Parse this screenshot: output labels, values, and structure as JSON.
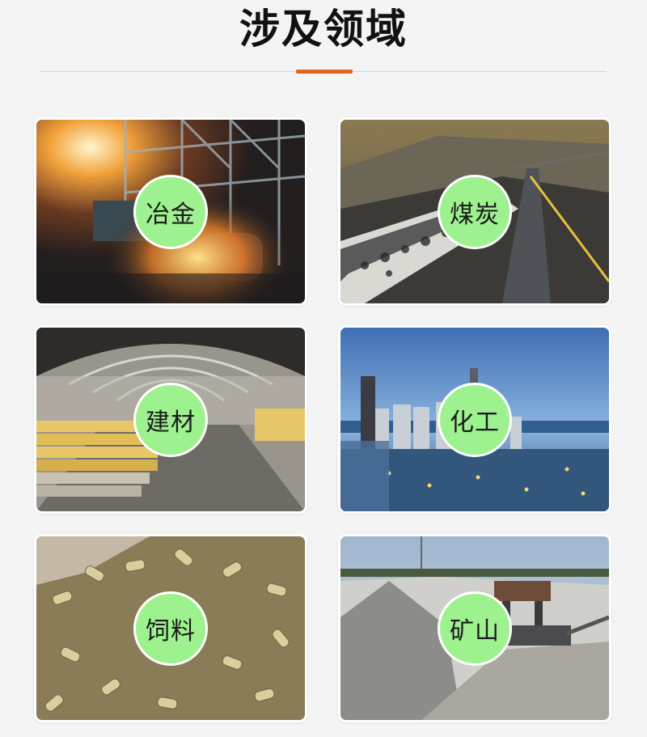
{
  "header": {
    "title": "涉及领域"
  },
  "fields": [
    {
      "label": "冶金",
      "image": "metallurgy-furnace-sparks-photo"
    },
    {
      "label": "煤炭",
      "image": "coal-conveyor-belt-photo"
    },
    {
      "label": "建材",
      "image": "building-materials-warehouse-photo"
    },
    {
      "label": "化工",
      "image": "chemical-plant-photo"
    },
    {
      "label": "饲料",
      "image": "feed-pellets-photo"
    },
    {
      "label": "矿山",
      "image": "mine-quarry-machinery-photo"
    }
  ],
  "colors": {
    "accent": "#e0661f",
    "badge": "#9df28f",
    "page_background": "#f4f4f4"
  }
}
